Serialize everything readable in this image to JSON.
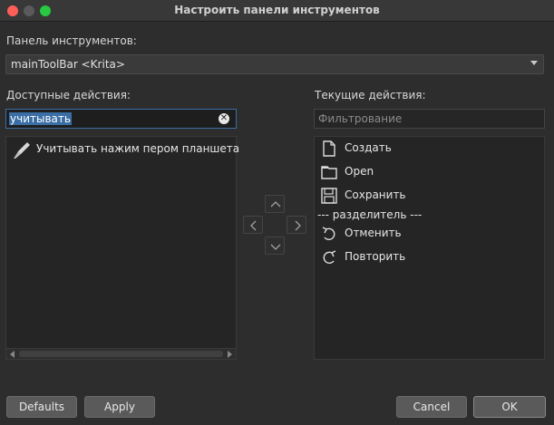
{
  "window": {
    "title": "Настроить панели инструментов"
  },
  "toolbar_section": {
    "label": "Панель инструментов:",
    "selected": "mainToolBar <Krita>"
  },
  "available": {
    "label": "Доступные действия:",
    "search_value": "учитывать",
    "items": [
      {
        "label": "Учитывать нажим пером планшета",
        "icon": "pen-pressure-icon"
      }
    ]
  },
  "current": {
    "label": "Текущие действия:",
    "filter_placeholder": "Фильтрование",
    "items": [
      {
        "label": "Создать",
        "icon": "new-document-icon"
      },
      {
        "label": "Open",
        "icon": "folder-icon"
      },
      {
        "label": "Сохранить",
        "icon": "save-icon"
      },
      {
        "label": "--- разделитель ---",
        "icon": ""
      },
      {
        "label": "Отменить",
        "icon": "undo-icon"
      },
      {
        "label": "Повторить",
        "icon": "redo-icon"
      }
    ]
  },
  "buttons": {
    "defaults": "Defaults",
    "apply": "Apply",
    "cancel": "Cancel",
    "ok": "OK"
  }
}
